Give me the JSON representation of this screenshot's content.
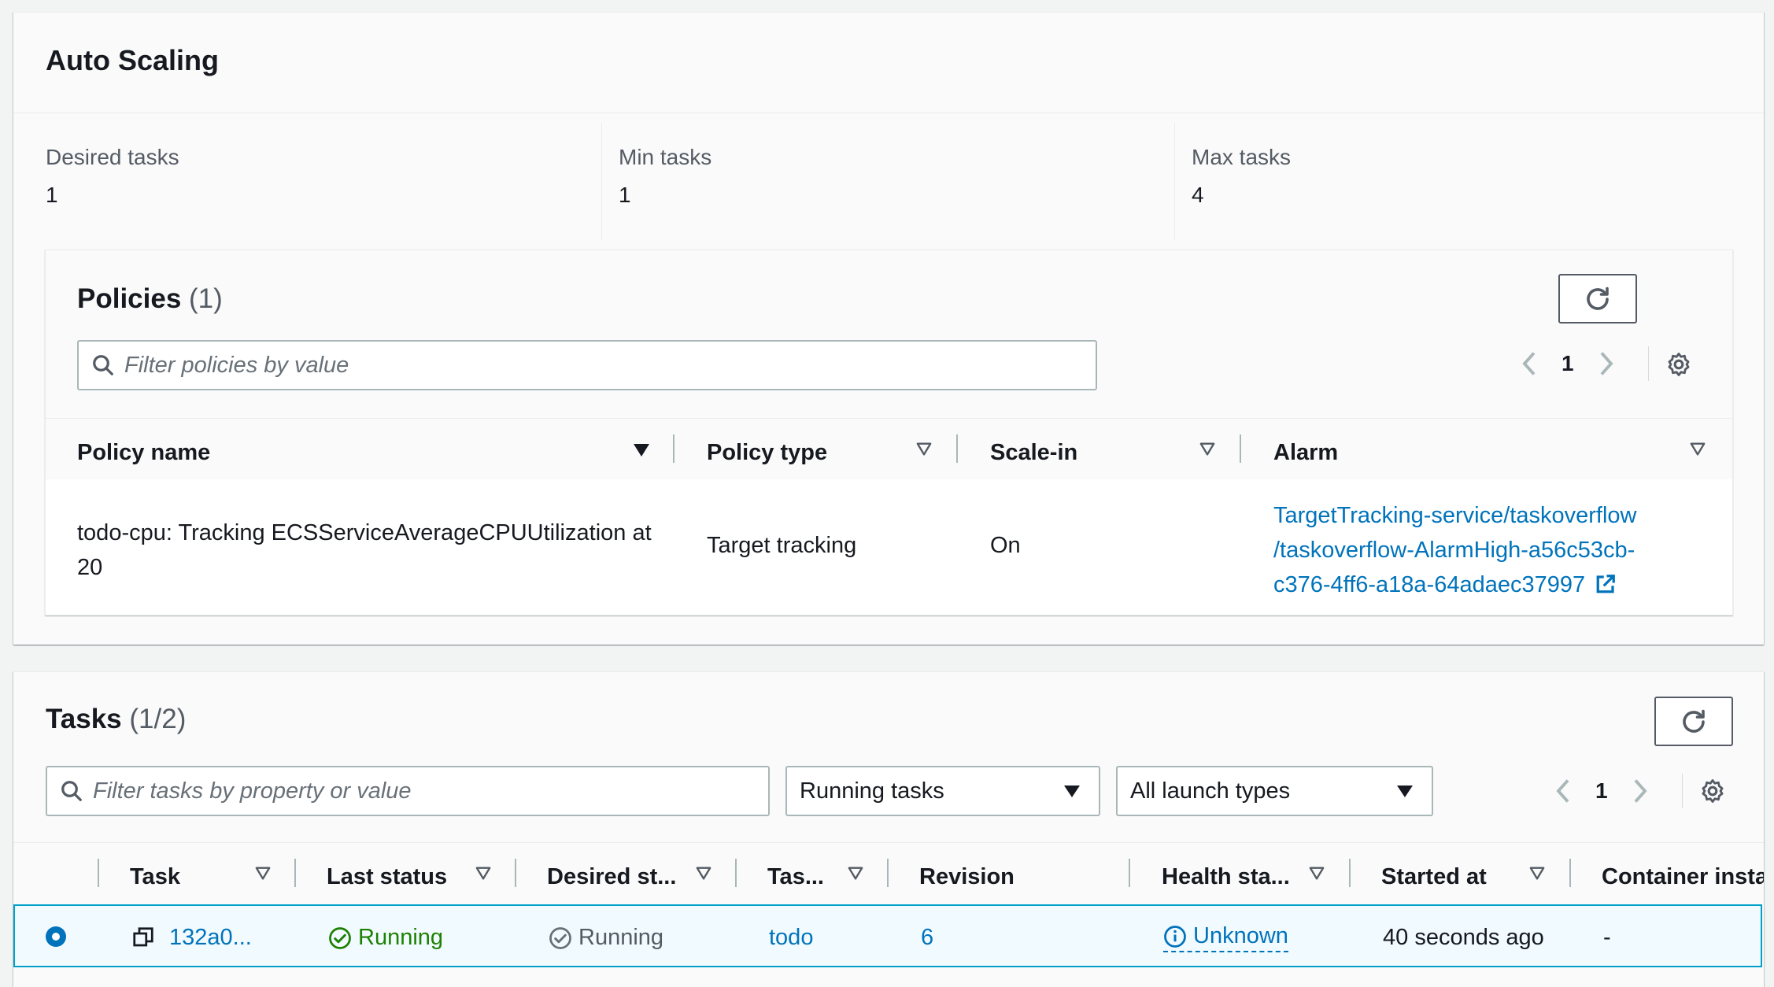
{
  "auto_scaling": {
    "title": "Auto Scaling",
    "desired": {
      "label": "Desired tasks",
      "value": "1"
    },
    "min": {
      "label": "Min tasks",
      "value": "1"
    },
    "max": {
      "label": "Max tasks",
      "value": "4"
    }
  },
  "policies": {
    "title": "Policies",
    "count": "(1)",
    "search_placeholder": "Filter policies by value",
    "page": "1",
    "columns": [
      "Policy name",
      "Policy type",
      "Scale-in",
      "Alarm"
    ],
    "rows": [
      {
        "name_line1": "todo-cpu: Tracking ECSServiceAverageCPUUtilization at",
        "name_line2": "20",
        "type": "Target tracking",
        "scale_in": "On",
        "alarm_line1": "TargetTracking-service/taskoverflow",
        "alarm_line2": "/taskoverflow-AlarmHigh-a56c53cb-",
        "alarm_line3": "c376-4ff6-a18a-64adaec37997"
      }
    ]
  },
  "tasks": {
    "title": "Tasks",
    "count": "(1/2)",
    "search_placeholder": "Filter tasks by property or value",
    "status_filter": "Running tasks",
    "launch_filter": "All launch types",
    "page": "1",
    "columns": [
      "Task",
      "Last status",
      "Desired st...",
      "Tas...",
      "Revision",
      "Health sta...",
      "Started at",
      "Container instar"
    ],
    "rows": [
      {
        "task": "132a0...",
        "last_status": "Running",
        "desired_status": "Running",
        "task_def": "todo",
        "revision": "6",
        "health": "Unknown",
        "started": "40 seconds ago",
        "container": "-"
      }
    ]
  },
  "colors": {
    "link": "#0073bb",
    "success": "#1d8102",
    "selected_row_bg": "#f1faff",
    "selected_row_border": "#00a1c9"
  },
  "icons": [
    "refresh-icon",
    "search-icon",
    "settings-icon",
    "chevron-left-icon",
    "chevron-right-icon",
    "sort-icon",
    "external-link-icon",
    "status-success-icon",
    "status-stopped-icon",
    "info-icon",
    "copy-icon",
    "radio-selected-icon",
    "caret-down-icon"
  ]
}
